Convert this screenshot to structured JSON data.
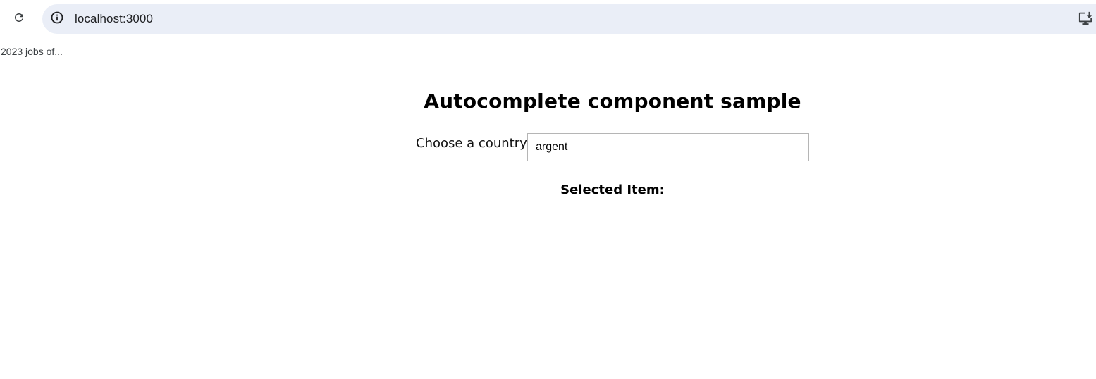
{
  "browser": {
    "url": "localhost:3000",
    "icons": {
      "reload": "reload-icon",
      "site_info": "info-icon",
      "install": "install-app-icon"
    }
  },
  "bookmarks_bar": {
    "items": [
      {
        "label": "2023 jobs of..."
      }
    ]
  },
  "page": {
    "title": "Autocomplete component sample",
    "country_label": "Choose a country:",
    "country_input_value": "argent",
    "selected_item_label": "Selected Item:"
  },
  "colors": {
    "omnibox_bg": "#eaeef7",
    "text": "#000000"
  }
}
